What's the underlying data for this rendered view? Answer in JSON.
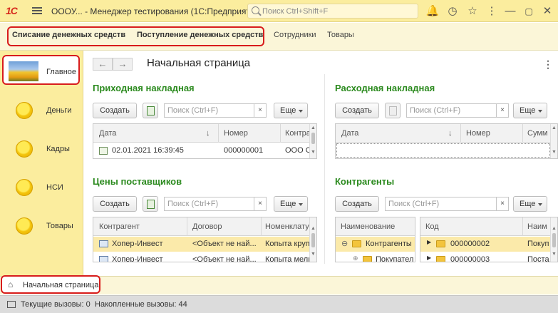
{
  "titlebar": {
    "logo": "1С",
    "title": "ОООУ... - Менеджер тестирования (1С:Предприятие)",
    "search_placeholder": "Поиск Ctrl+Shift+F",
    "icons": [
      "hamburger-menu-icon",
      "bell-icon",
      "history-icon",
      "star-icon",
      "more-vertical-icon",
      "minimize-icon",
      "maximize-icon",
      "close-icon"
    ]
  },
  "sections": {
    "items": [
      "Списание денежных средств",
      "Поступление денежных средств",
      "Сотрудники",
      "Товары"
    ]
  },
  "sidebar": {
    "items": [
      {
        "label": "Главное",
        "icon": "home-image-icon"
      },
      {
        "label": "Деньги",
        "icon": "circle-icon"
      },
      {
        "label": "Кадры",
        "icon": "circle-icon"
      },
      {
        "label": "НСИ",
        "icon": "circle-icon"
      },
      {
        "label": "Товары",
        "icon": "circle-icon"
      }
    ]
  },
  "page": {
    "title": "Начальная страница",
    "back": "←",
    "forward": "→"
  },
  "common": {
    "create": "Создать",
    "more": "Еще",
    "search_placeholder": "Поиск (Ctrl+F)",
    "clear": "×"
  },
  "panels": {
    "incoming": {
      "title": "Приходная накладная",
      "columns": [
        "Дата",
        "Номер",
        "Контра"
      ],
      "sort_arrow": "↓",
      "rows": [
        {
          "date": "02.01.2021 16:39:45",
          "number": "000000001",
          "counterparty": "ООО С"
        }
      ]
    },
    "outgoing": {
      "title": "Расходная накладная",
      "columns": [
        "Дата",
        "Номер",
        "Сумм"
      ],
      "sort_arrow": "↓"
    },
    "prices": {
      "title": "Цены поставщиков",
      "columns": [
        "Контрагент",
        "Договор",
        "Номенклату"
      ],
      "rows": [
        {
          "c": "Хопер-Инвест",
          "d": "<Объект не най...",
          "n": "Копыта круп"
        },
        {
          "c": "Хопер-Инвест",
          "d": "<Объект не най...",
          "n": "Копыта мелк"
        }
      ]
    },
    "contractors": {
      "title": "Контрагенты",
      "tree_header": "Наименование",
      "tree_rows": [
        "Контрагенты",
        "Покупател"
      ],
      "list_columns": [
        "Код",
        "Наим"
      ],
      "list_rows": [
        {
          "code": "000000002",
          "name": "Покуп"
        },
        {
          "code": "000000003",
          "name": "Поста"
        }
      ]
    }
  },
  "tabs": {
    "home": "Начальная страница"
  },
  "status": {
    "current": "Текущие вызовы: 0",
    "accumulated": "Накопленные вызовы: 44"
  },
  "colors": {
    "accent_green": "#2b8a1e",
    "highlight_red": "#d81c1c",
    "titlebar": "#fbed9e"
  }
}
